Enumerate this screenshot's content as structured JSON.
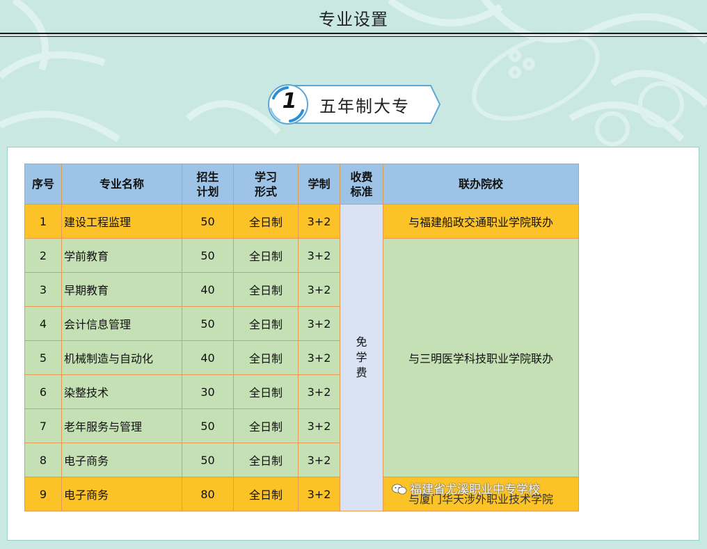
{
  "page_title": "专业设置",
  "section": {
    "number": "1",
    "label": "五年制大专"
  },
  "table": {
    "headers": {
      "index": "序号",
      "name": "专业名称",
      "plan": [
        "招生",
        "计划"
      ],
      "mode": [
        "学习",
        "形式"
      ],
      "years": "学制",
      "fee": [
        "收费",
        "标准"
      ],
      "partner": "联办院校"
    },
    "rows": [
      {
        "index": "1",
        "name": "建设工程监理",
        "plan": "50",
        "mode": "全日制",
        "years": "3+2"
      },
      {
        "index": "2",
        "name": "学前教育",
        "plan": "50",
        "mode": "全日制",
        "years": "3+2"
      },
      {
        "index": "3",
        "name": "早期教育",
        "plan": "40",
        "mode": "全日制",
        "years": "3+2"
      },
      {
        "index": "4",
        "name": "会计信息管理",
        "plan": "50",
        "mode": "全日制",
        "years": "3+2"
      },
      {
        "index": "5",
        "name": "机械制造与自动化",
        "plan": "40",
        "mode": "全日制",
        "years": "3+2"
      },
      {
        "index": "6",
        "name": "染整技术",
        "plan": "30",
        "mode": "全日制",
        "years": "3+2"
      },
      {
        "index": "7",
        "name": "老年服务与管理",
        "plan": "50",
        "mode": "全日制",
        "years": "3+2"
      },
      {
        "index": "8",
        "name": "电子商务",
        "plan": "50",
        "mode": "全日制",
        "years": "3+2"
      },
      {
        "index": "9",
        "name": "电子商务",
        "plan": "80",
        "mode": "全日制",
        "years": "3+2"
      }
    ],
    "fee_text": [
      "免",
      "学",
      "费"
    ],
    "partners": [
      "与福建船政交通职业学院联办",
      "与三明医学科技职业学院联办",
      "与厦门华天涉外职业技术学院"
    ]
  },
  "watermark": "福建省尤溪职业中专学校",
  "colors": {
    "background": "#c9e8e2",
    "header": "#9dc3e6",
    "highlight_row": "#fbc327",
    "green_row": "#c5e0b4",
    "fee_column": "#dae3f3",
    "border": "#e49a52"
  }
}
